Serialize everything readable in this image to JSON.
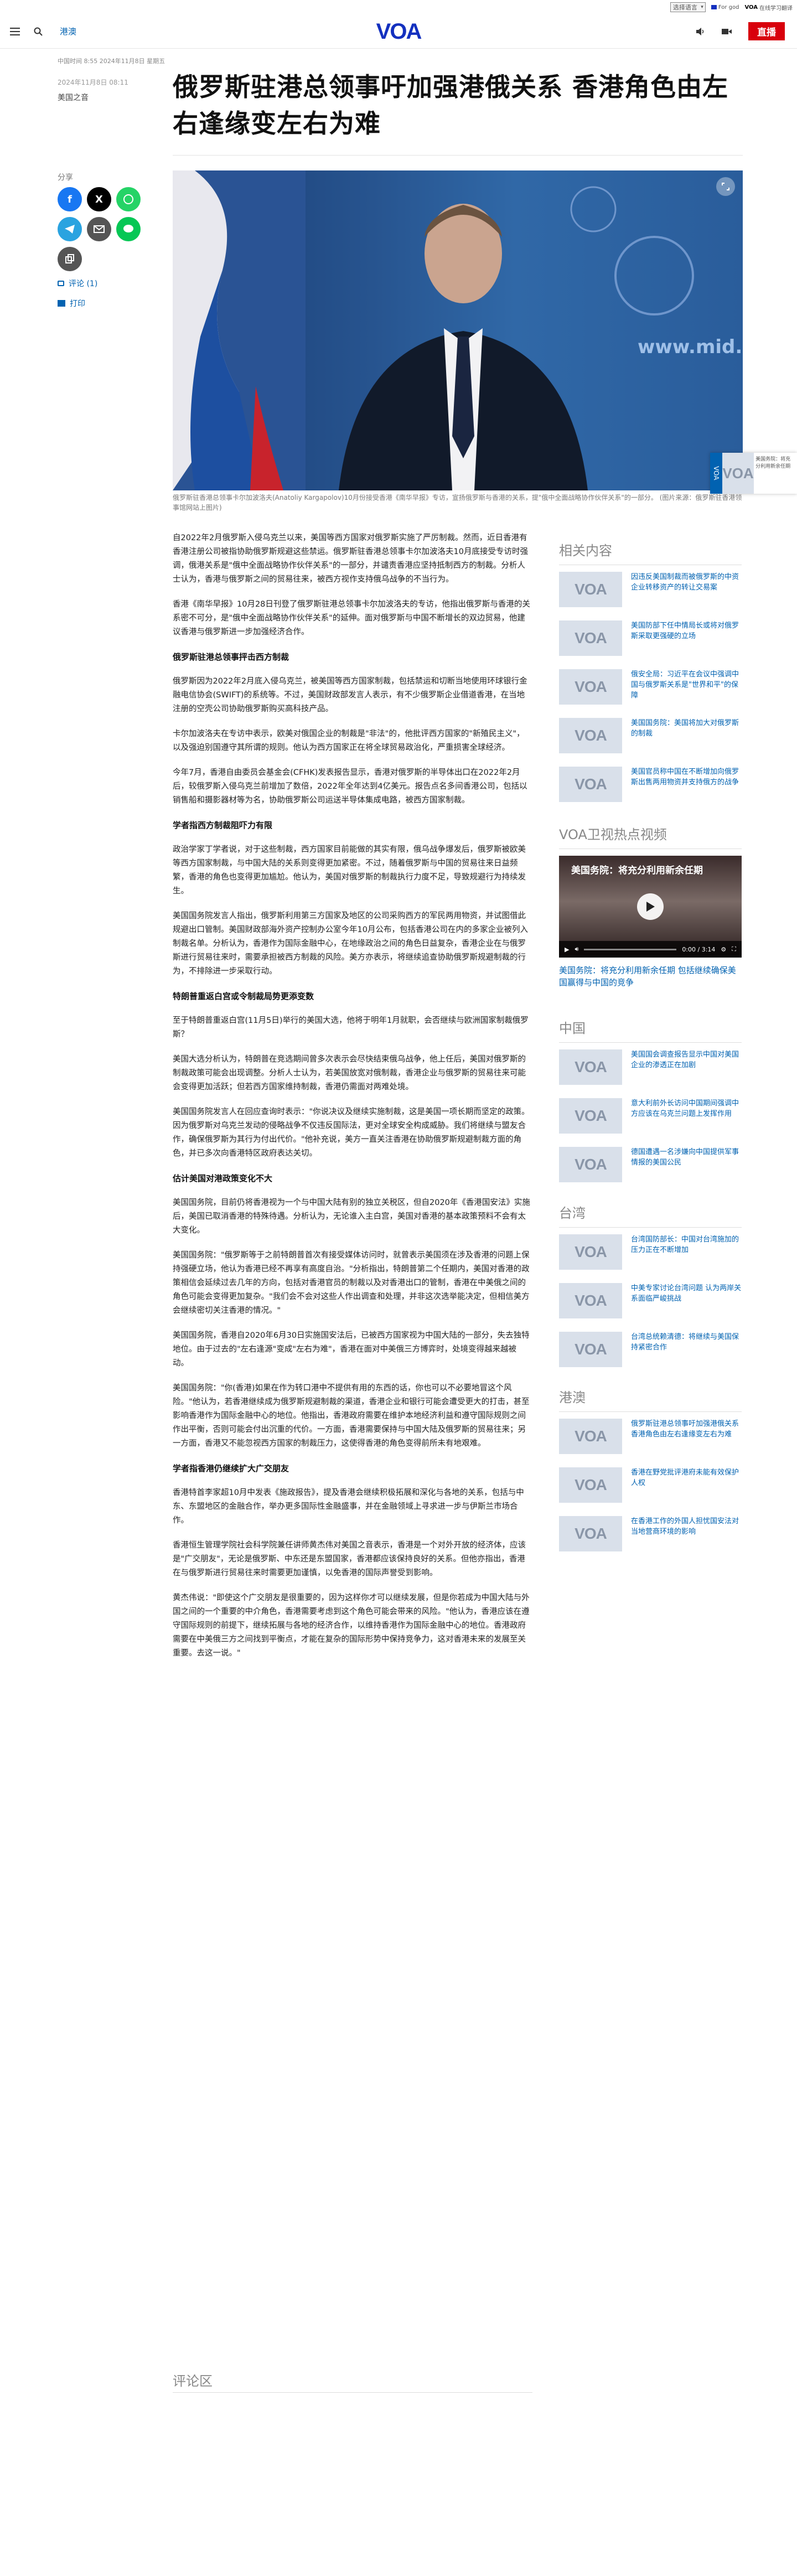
{
  "utility": {
    "language": "选择语言",
    "link1_icon": "voa-mini-icon",
    "link1": "For god",
    "link2_b": "VOA",
    "link2": "在线学习翻译"
  },
  "header": {
    "section": "港澳",
    "logo": "VOA",
    "live": "直播"
  },
  "article": {
    "meta": "中国时间 8:55 2024年11月8日 星期五",
    "date": "2024年11月8日 08:11",
    "author": "美国之音",
    "headline": "俄罗斯驻港总领事吁加强港俄关系 香港角色由左右逢缘变左右为难",
    "caption": "俄罗斯驻香港总领事卡尔加波洛夫(Anatoliy Kargapolov)10月份接受香港《南华早报》专访，宣扬俄罗斯与香港的关系，提\"俄中全面战略协作伙伴关系\"的一部分。 (图片来源：俄罗斯驻香港领事馆网站上图片)",
    "share_label": "分享",
    "comments": "评论 (1)",
    "print": "打印"
  },
  "body": [
    {
      "t": "p",
      "v": "自2022年2月俄罗斯入侵乌克兰以来，美国等西方国家对俄罗斯实施了严厉制裁。然而，近日香港有香港注册公司被指协助俄罗斯规避这些禁运。俄罗斯驻香港总领事卡尔加波洛夫10月底接受专访时强调，俄港关系是\"俄中全面战略协作伙伴关系\"的一部分，并谴责香港应坚持抵制西方的制裁。分析人士认为，香港与俄罗斯之间的贸易往来，被西方视作支持俄乌战争的不当行为。"
    },
    {
      "t": "p",
      "v": "香港《南华早报》10月28日刊登了俄罗斯驻港总领事卡尔加波洛夫的专访，他指出俄罗斯与香港的关系密不可分，是\"俄中全面战略协作伙伴关系\"的延伸。面对俄罗斯与中国不断增长的双边贸易，他建议香港与俄罗斯进一步加强经济合作。"
    },
    {
      "t": "h",
      "v": "俄罗斯驻港总领事抨击西方制裁"
    },
    {
      "t": "p",
      "v": "俄罗斯因为2022年2月底入侵乌克兰，被美国等西方国家制裁，包括禁运和切断当地使用环球银行金融电信协会(SWIFT)的系统等。不过，美国财政部发言人表示，有不少俄罗斯企业借道香港，在当地注册的空壳公司协助俄罗斯购买高科技产品。"
    },
    {
      "t": "p",
      "v": "卡尔加波洛夫在专访中表示，欧美对俄国企业的制裁是\"非法\"的，他批评西方国家的\"新殖民主义\"，以及强迫别国遵守其所谓的规则。他认为西方国家正在将全球贸易政治化，严重损害全球经济。"
    },
    {
      "t": "p",
      "v": "今年7月，香港自由委员会基金会(CFHK)发表报告显示，香港对俄罗斯的半导体出口在2022年2月后，较俄罗斯入侵乌克兰前增加了数倍，2022年全年达到4亿美元。报告点名多间香港公司，包括以销售船和摄影器材等为名，协助俄罗斯公司运送半导体集成电路，被西方国家制裁。"
    },
    {
      "t": "h",
      "v": "学者指西方制裁阻吓力有限"
    },
    {
      "t": "p",
      "v": "政治学家丁学者说，对于这些制裁，西方国家目前能做的其实有限，俄乌战争爆发后，俄罗斯被欧美等西方国家制裁，与中国大陆的关系则变得更加紧密。不过，随着俄罗斯与中国的贸易往来日益频繁，香港的角色也变得更加尴尬。他认为，美国对俄罗斯的制裁执行力度不足，导致规避行为持续发生。"
    },
    {
      "t": "p",
      "v": "美国国务院发言人指出，俄罗斯利用第三方国家及地区的公司采购西方的军民两用物资，并试图借此规避出口管制。美国财政部海外资产控制办公室今年10月公布，包括香港公司在内的多家企业被列入制裁名单。分析认为，香港作为国际金融中心，在地缘政治之间的角色日益复杂，香港企业在与俄罗斯进行贸易往来时，需要承担被西方制裁的风险。美方亦表示，将继续追查协助俄罗斯规避制裁的行为，不排除进一步采取行动。"
    },
    {
      "t": "h",
      "v": "特朗普重返白宫或令制裁局势更添变数"
    },
    {
      "t": "p",
      "v": "至于特朗普重返白宫(11月5日)举行的美国大选，他将于明年1月就职，会否继续与欧洲国家制裁俄罗斯？"
    },
    {
      "t": "p",
      "v": "美国大选分析认为，特朗普在竞选期间曾多次表示会尽快结束俄乌战争，他上任后，美国对俄罗斯的制裁政策可能会出现调整。分析人士认为，若美国放宽对俄制裁，香港企业与俄罗斯的贸易往来可能会变得更加活跃；但若西方国家维持制裁，香港仍需面对两难处境。"
    },
    {
      "t": "p",
      "v": "美国国务院发言人在回应查询时表示：\"你说决议及继续实施制裁，这是美国一项长期而坚定的政策。因为俄罗斯对乌克兰发动的侵略战争不仅违反国际法，更对全球安全构成威胁。我们将继续与盟友合作，确保俄罗斯为其行为付出代价。\"他补充说，美方一直关注香港在协助俄罗斯规避制裁方面的角色，并已多次向香港特区政府表达关切。"
    },
    {
      "t": "h",
      "v": "估计美国对港政策变化不大"
    },
    {
      "t": "p",
      "v": "美国国务院，目前仍将香港视为一个与中国大陆有别的独立关税区，但自2020年《香港国安法》实施后，美国已取消香港的特殊待遇。分析认为，无论谁入主白宫，美国对香港的基本政策预料不会有太大变化。"
    },
    {
      "t": "p",
      "v": "美国国务院：\"俄罗斯等于之前特朗普首次有接受媒体访问时，就曾表示美国须在涉及香港的问题上保持强硬立场，他认为香港已经不再享有高度自治。\"分析指出，特朗普第二个任期内，美国对香港的政策相信会延续过去几年的方向，包括对香港官员的制裁以及对香港出口的管制，香港在中美俄之间的角色可能会变得更加复杂。\"我们会不会对这些人作出调查和处理，并非这次选举能决定，但相信美方会继续密切关注香港的情况。\""
    },
    {
      "t": "p",
      "v": "美国国务院，香港自2020年6月30日实施国安法后，已被西方国家视为中国大陆的一部分，失去独特地位。由于过去的\"左右逢源\"变成\"左右为难\"，香港在面对中美俄三方博弈时，处境变得越来越被动。"
    },
    {
      "t": "p",
      "v": "美国国务院：\"你(香港)如果在作为转口港中不提供有用的东西的话，你也可以不必要地冒这个风险。\"他认为，若香港继续成为俄罗斯规避制裁的渠道，香港企业和银行可能会遭受更大的打击，甚至影响香港作为国际金融中心的地位。他指出，香港政府需要在维护本地经济利益和遵守国际规则之间作出平衡，否则可能会付出沉重的代价。一方面，香港需要保持与中国大陆及俄罗斯的贸易往来；另一方面，香港又不能忽视西方国家的制裁压力，这使得香港的角色变得前所未有地艰难。"
    },
    {
      "t": "h",
      "v": "学者指香港仍继续扩大广交朋友"
    },
    {
      "t": "p",
      "v": "香港特首李家超10月中发表《施政报告》，提及香港会继续积极拓展和深化与各地的关系，包括与中东、东盟地区的金融合作，举办更多国际性金融盛事，并在金融领域上寻求进一步与伊斯兰市场合作。"
    },
    {
      "t": "p",
      "v": "香港恒生管理学院社会科学院兼任讲师黄杰伟对美国之音表示，香港是一个对外开放的经济体，应该是\"广交朋友\"，无论是俄罗斯、中东还是东盟国家，香港都应该保持良好的关系。但他亦指出，香港在与俄罗斯进行贸易往来时需要更加谨慎，以免香港的国际声誉受到影响。"
    },
    {
      "t": "p",
      "v": "黄杰伟说：\"即使这个广交朋友是很重要的，因为这样你才可以继续发展，但是你若成为中国大陆与外国之间的一个重要的中介角色，香港需要考虑到这个角色可能会带来的风险。\"他认为，香港应该在遵守国际规则的前提下，继续拓展与各地的经济合作，以维持香港作为国际金融中心的地位。香港政府需要在中美俄三方之间找到平衡点，才能在复杂的国际形势中保持竞争力，这对香港未来的发展至关重要。去这一说。\""
    }
  ],
  "comment_header": "评论区",
  "rail": {
    "related_title": "相关内容",
    "related": [
      "因违反美国制裁而被俄罗斯的中资企业转移资产的转让交易案",
      "美国防部下任中情局长或将对俄罗斯采取更强硬的立场",
      "俄安全局：习近平在会议中强调中国与俄罗斯关系是\"世界和平\"的保障",
      "美国国务院：美国将加大对俄罗斯的制裁",
      "美国官员称中国在不断增加向俄罗斯出售两用物资并支持俄方的战争"
    ],
    "video_section_title": "VOA卫视热点视频",
    "video_overlay": "美国务院：将充分利用新余任期",
    "video_time": "0:00 / 3:14",
    "video_caption": "美国务院：将充分利用新余任期 包括继续确保美国赢得与中国的竞争",
    "china_title": "中国",
    "china": [
      "美国国会调查报告显示中国对美国企业的渗透正在加剧",
      "意大利前外长访问中国期间强调中方应该在乌克兰问题上发挥作用",
      "德国遭遇一名涉嫌向中国提供军事情报的美国公民"
    ],
    "taiwan_title": "台湾",
    "taiwan": [
      "台湾国防部长：中国对台湾施加的压力正在不断增加",
      "中美专家讨论台湾问题 认为两岸关系面临严峻挑战",
      "台湾总统赖清德：将继续与美国保持紧密合作"
    ],
    "hk_title": "港澳",
    "hk": [
      "俄罗斯驻港总领事吁加强港俄关系 香港角色由左右逢缘变左右为难",
      "香港在野党批评港府未能有效保护人权",
      "在香港工作的外国人担忧国安法对当地营商环境的影响"
    ]
  },
  "float_widget": {
    "tab": "VOA",
    "logo": "VOA",
    "text": "美国务院：将充分利用新余任期"
  }
}
